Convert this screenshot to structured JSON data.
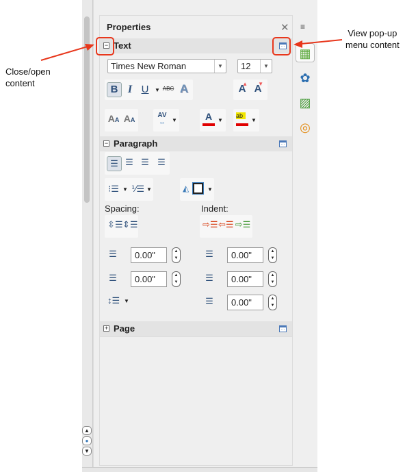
{
  "panel": {
    "title": "Properties",
    "close_icon": "close-icon",
    "menu_icon": "sidebar-menu-icon"
  },
  "text_section": {
    "title": "Text",
    "font_name": "Times New Roman",
    "font_size": "12",
    "tools": [
      "bold",
      "italic",
      "underline",
      "strikethrough",
      "shadow",
      "grow-font",
      "shrink-font",
      "superscript",
      "subscript",
      "character-spacing",
      "font-color",
      "highlight-color"
    ],
    "bold_label": "B",
    "italic_label": "I",
    "underline_label": "U",
    "strike_label": "ABC",
    "shadow_label": "A"
  },
  "paragraph_section": {
    "title": "Paragraph",
    "alignments": [
      "align-left",
      "align-center",
      "align-right",
      "justify"
    ],
    "spacing_label": "Spacing:",
    "indent_label": "Indent:",
    "above_spacing": "0.00\"",
    "below_spacing": "0.00\"",
    "before_indent": "0.00\"",
    "after_indent": "0.00\"",
    "first_line_indent": "0.00\""
  },
  "page_section": {
    "title": "Page"
  },
  "tabs": [
    "properties",
    "styles",
    "gallery",
    "navigator"
  ],
  "annotations": {
    "left": "Close/open\ncontent",
    "right": "View pop-up\nmenu content"
  },
  "colors": {
    "annotation": "#e8371c",
    "font_color": "#e00000",
    "highlight": "#f2e600"
  }
}
